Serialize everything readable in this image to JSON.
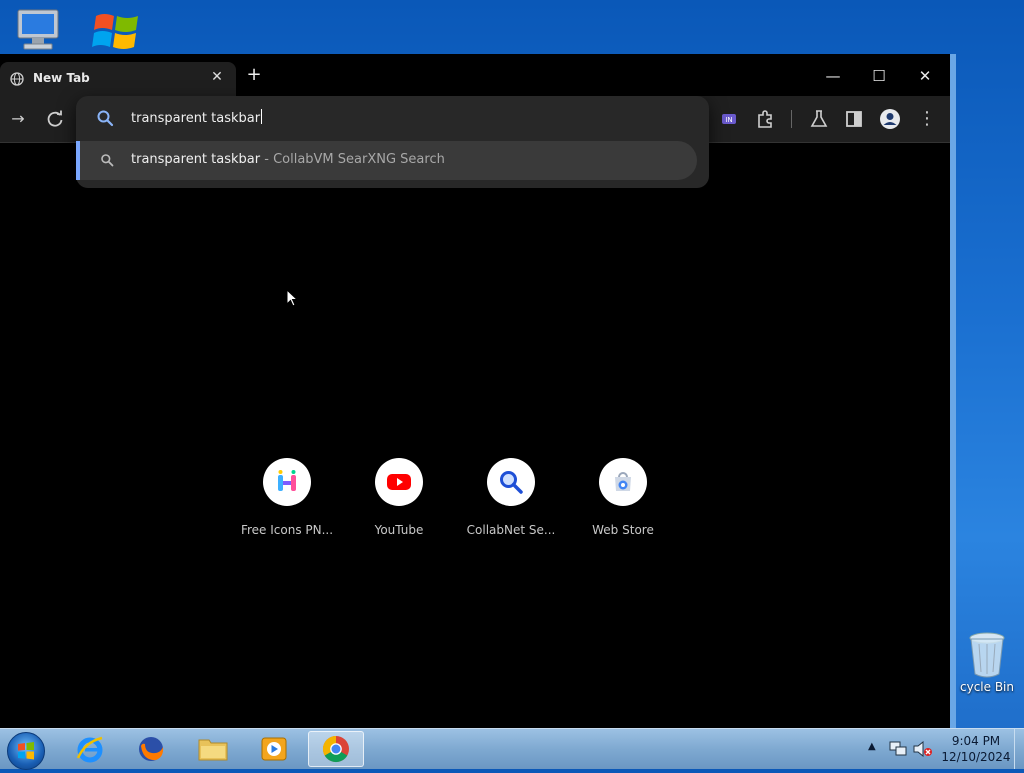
{
  "desktop": {
    "icons": [
      {
        "name": "computer"
      },
      {
        "name": "windows-logo"
      },
      {
        "label": "cycle Bin"
      }
    ]
  },
  "browser": {
    "tab": {
      "title": "New Tab",
      "close": "✕"
    },
    "new_tab": "+",
    "window_controls": {
      "minimize": "—",
      "maximize": "☐",
      "close": "✕"
    },
    "omnibox": {
      "value": "transparent taskbar",
      "suggestion": {
        "query": "transparent taskbar",
        "separator": " - ",
        "engine": "CollabVM SearXNG Search"
      }
    },
    "shortcuts": [
      {
        "label": "Free Icons PN..."
      },
      {
        "label": "YouTube"
      },
      {
        "label": "CollabNet Se..."
      },
      {
        "label": "Web Store"
      }
    ]
  },
  "taskbar": {
    "apps": [
      "internet-explorer",
      "firefox",
      "file-explorer",
      "media-player",
      "chrome"
    ],
    "clock": {
      "time": "9:04 PM",
      "date": "12/10/2024"
    }
  },
  "colors": {
    "accent": "#7aa7ff",
    "tab_bg": "#1f1f1f",
    "dropdown_bg": "#282828"
  }
}
